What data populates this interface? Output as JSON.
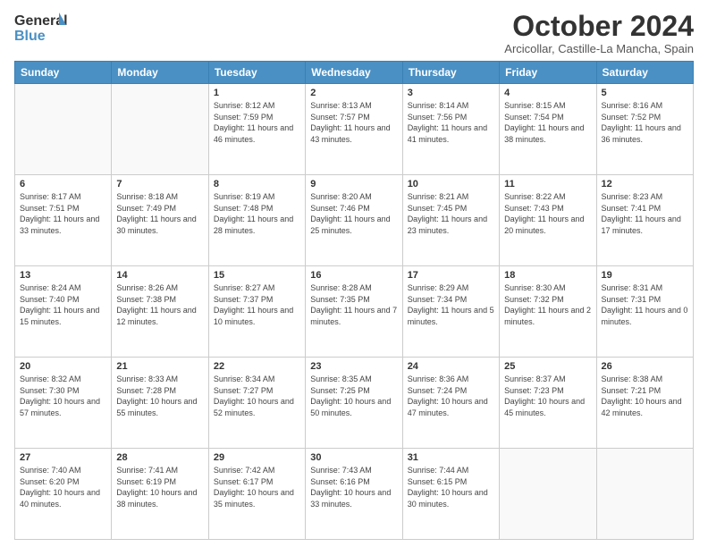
{
  "header": {
    "logo_line1": "General",
    "logo_line2": "Blue",
    "month": "October 2024",
    "location": "Arcicollar, Castille-La Mancha, Spain"
  },
  "weekdays": [
    "Sunday",
    "Monday",
    "Tuesday",
    "Wednesday",
    "Thursday",
    "Friday",
    "Saturday"
  ],
  "weeks": [
    [
      {
        "day": "",
        "info": ""
      },
      {
        "day": "",
        "info": ""
      },
      {
        "day": "1",
        "info": "Sunrise: 8:12 AM\nSunset: 7:59 PM\nDaylight: 11 hours and 46 minutes."
      },
      {
        "day": "2",
        "info": "Sunrise: 8:13 AM\nSunset: 7:57 PM\nDaylight: 11 hours and 43 minutes."
      },
      {
        "day": "3",
        "info": "Sunrise: 8:14 AM\nSunset: 7:56 PM\nDaylight: 11 hours and 41 minutes."
      },
      {
        "day": "4",
        "info": "Sunrise: 8:15 AM\nSunset: 7:54 PM\nDaylight: 11 hours and 38 minutes."
      },
      {
        "day": "5",
        "info": "Sunrise: 8:16 AM\nSunset: 7:52 PM\nDaylight: 11 hours and 36 minutes."
      }
    ],
    [
      {
        "day": "6",
        "info": "Sunrise: 8:17 AM\nSunset: 7:51 PM\nDaylight: 11 hours and 33 minutes."
      },
      {
        "day": "7",
        "info": "Sunrise: 8:18 AM\nSunset: 7:49 PM\nDaylight: 11 hours and 30 minutes."
      },
      {
        "day": "8",
        "info": "Sunrise: 8:19 AM\nSunset: 7:48 PM\nDaylight: 11 hours and 28 minutes."
      },
      {
        "day": "9",
        "info": "Sunrise: 8:20 AM\nSunset: 7:46 PM\nDaylight: 11 hours and 25 minutes."
      },
      {
        "day": "10",
        "info": "Sunrise: 8:21 AM\nSunset: 7:45 PM\nDaylight: 11 hours and 23 minutes."
      },
      {
        "day": "11",
        "info": "Sunrise: 8:22 AM\nSunset: 7:43 PM\nDaylight: 11 hours and 20 minutes."
      },
      {
        "day": "12",
        "info": "Sunrise: 8:23 AM\nSunset: 7:41 PM\nDaylight: 11 hours and 17 minutes."
      }
    ],
    [
      {
        "day": "13",
        "info": "Sunrise: 8:24 AM\nSunset: 7:40 PM\nDaylight: 11 hours and 15 minutes."
      },
      {
        "day": "14",
        "info": "Sunrise: 8:26 AM\nSunset: 7:38 PM\nDaylight: 11 hours and 12 minutes."
      },
      {
        "day": "15",
        "info": "Sunrise: 8:27 AM\nSunset: 7:37 PM\nDaylight: 11 hours and 10 minutes."
      },
      {
        "day": "16",
        "info": "Sunrise: 8:28 AM\nSunset: 7:35 PM\nDaylight: 11 hours and 7 minutes."
      },
      {
        "day": "17",
        "info": "Sunrise: 8:29 AM\nSunset: 7:34 PM\nDaylight: 11 hours and 5 minutes."
      },
      {
        "day": "18",
        "info": "Sunrise: 8:30 AM\nSunset: 7:32 PM\nDaylight: 11 hours and 2 minutes."
      },
      {
        "day": "19",
        "info": "Sunrise: 8:31 AM\nSunset: 7:31 PM\nDaylight: 11 hours and 0 minutes."
      }
    ],
    [
      {
        "day": "20",
        "info": "Sunrise: 8:32 AM\nSunset: 7:30 PM\nDaylight: 10 hours and 57 minutes."
      },
      {
        "day": "21",
        "info": "Sunrise: 8:33 AM\nSunset: 7:28 PM\nDaylight: 10 hours and 55 minutes."
      },
      {
        "day": "22",
        "info": "Sunrise: 8:34 AM\nSunset: 7:27 PM\nDaylight: 10 hours and 52 minutes."
      },
      {
        "day": "23",
        "info": "Sunrise: 8:35 AM\nSunset: 7:25 PM\nDaylight: 10 hours and 50 minutes."
      },
      {
        "day": "24",
        "info": "Sunrise: 8:36 AM\nSunset: 7:24 PM\nDaylight: 10 hours and 47 minutes."
      },
      {
        "day": "25",
        "info": "Sunrise: 8:37 AM\nSunset: 7:23 PM\nDaylight: 10 hours and 45 minutes."
      },
      {
        "day": "26",
        "info": "Sunrise: 8:38 AM\nSunset: 7:21 PM\nDaylight: 10 hours and 42 minutes."
      }
    ],
    [
      {
        "day": "27",
        "info": "Sunrise: 7:40 AM\nSunset: 6:20 PM\nDaylight: 10 hours and 40 minutes."
      },
      {
        "day": "28",
        "info": "Sunrise: 7:41 AM\nSunset: 6:19 PM\nDaylight: 10 hours and 38 minutes."
      },
      {
        "day": "29",
        "info": "Sunrise: 7:42 AM\nSunset: 6:17 PM\nDaylight: 10 hours and 35 minutes."
      },
      {
        "day": "30",
        "info": "Sunrise: 7:43 AM\nSunset: 6:16 PM\nDaylight: 10 hours and 33 minutes."
      },
      {
        "day": "31",
        "info": "Sunrise: 7:44 AM\nSunset: 6:15 PM\nDaylight: 10 hours and 30 minutes."
      },
      {
        "day": "",
        "info": ""
      },
      {
        "day": "",
        "info": ""
      }
    ]
  ]
}
